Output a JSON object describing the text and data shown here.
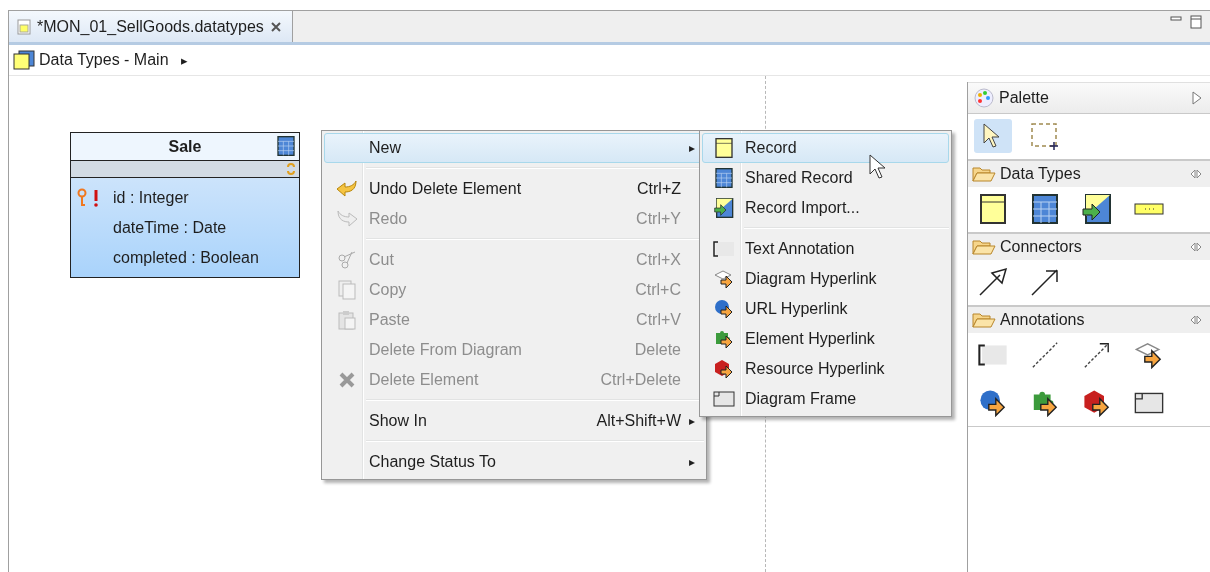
{
  "editor_tab": {
    "title": "*MON_01_SellGoods.datatypes",
    "selected": true
  },
  "breadcrumb": {
    "label": "Data Types - Main",
    "arrow": "▸"
  },
  "record": {
    "name": "Sale",
    "attributes": [
      {
        "text": "id : Integer",
        "key": true,
        "required": true
      },
      {
        "text": "dateTime : Date"
      },
      {
        "text": "completed : Boolean"
      }
    ]
  },
  "context_menu": [
    {
      "kind": "item",
      "label": "New",
      "submenu": true,
      "disabled": false,
      "selected": true
    },
    {
      "kind": "separator"
    },
    {
      "kind": "item",
      "label": "Undo Delete Element",
      "shortcut": "Ctrl+Z",
      "submenu": false,
      "disabled": false,
      "selected": false
    },
    {
      "kind": "item",
      "label": "Redo",
      "shortcut": "Ctrl+Y",
      "submenu": false,
      "disabled": true,
      "selected": false
    },
    {
      "kind": "separator"
    },
    {
      "kind": "item",
      "label": "Cut",
      "shortcut": "Ctrl+X",
      "submenu": false,
      "disabled": true,
      "selected": false
    },
    {
      "kind": "item",
      "label": "Copy",
      "shortcut": "Ctrl+C",
      "submenu": false,
      "disabled": true,
      "selected": false
    },
    {
      "kind": "item",
      "label": "Paste",
      "shortcut": "Ctrl+V",
      "submenu": false,
      "disabled": true,
      "selected": false
    },
    {
      "kind": "item",
      "label": "Delete From Diagram",
      "shortcut": "Delete",
      "submenu": false,
      "disabled": true,
      "selected": false
    },
    {
      "kind": "item",
      "label": "Delete Element",
      "shortcut": "Ctrl+Delete",
      "submenu": false,
      "disabled": true,
      "selected": false
    },
    {
      "kind": "separator"
    },
    {
      "kind": "item",
      "label": "Show In",
      "shortcut": "Alt+Shift+W",
      "submenu": true,
      "disabled": false,
      "selected": false
    },
    {
      "kind": "separator"
    },
    {
      "kind": "item",
      "label": "Change Status To",
      "submenu": true,
      "disabled": false,
      "selected": false
    }
  ],
  "new_submenu": [
    {
      "kind": "item",
      "label": "Record",
      "selected": true
    },
    {
      "kind": "item",
      "label": "Shared Record",
      "selected": false
    },
    {
      "kind": "item",
      "label": "Record Import...",
      "selected": false
    },
    {
      "kind": "separator"
    },
    {
      "kind": "item",
      "label": "Text Annotation",
      "selected": false
    },
    {
      "kind": "item",
      "label": "Diagram Hyperlink",
      "selected": false
    },
    {
      "kind": "item",
      "label": "URL Hyperlink",
      "selected": false
    },
    {
      "kind": "item",
      "label": "Element Hyperlink",
      "selected": false
    },
    {
      "kind": "item",
      "label": "Resource Hyperlink",
      "selected": false
    },
    {
      "kind": "item",
      "label": "Diagram Frame",
      "selected": false
    }
  ],
  "palette": {
    "title": "Palette",
    "tools": [
      {
        "selected": true
      },
      {
        "selected": false
      }
    ],
    "groups": [
      {
        "label": "Data Types",
        "expanded": true
      },
      {
        "label": "Connectors",
        "expanded": true
      },
      {
        "label": "Annotations",
        "expanded": true
      }
    ]
  }
}
